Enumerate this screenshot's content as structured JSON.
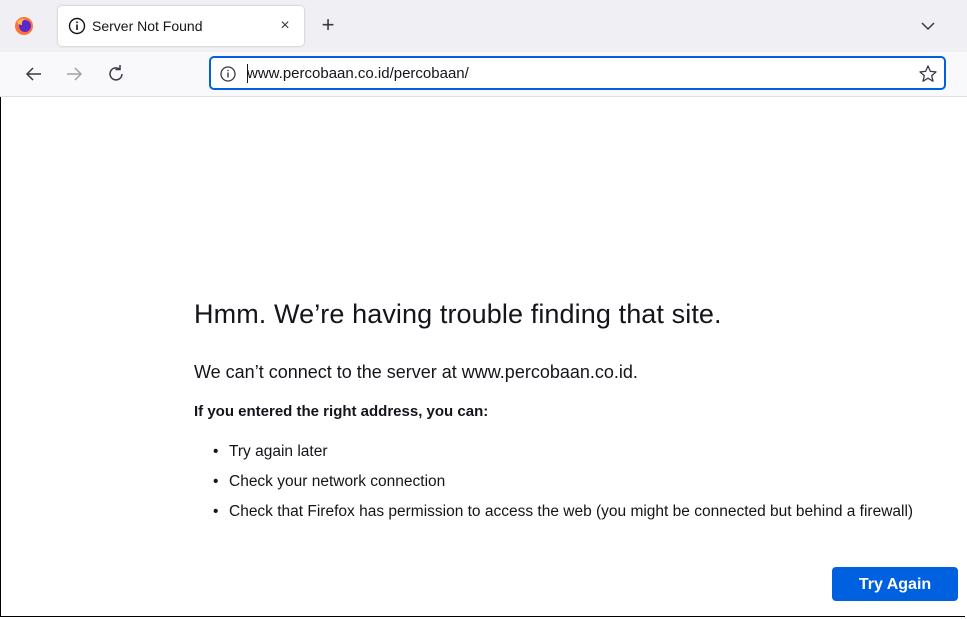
{
  "browser": {
    "tab": {
      "title": "Server Not Found",
      "close_label": "×"
    },
    "new_tab_label": "+",
    "url": "www.percobaan.co.id/percobaan/"
  },
  "error": {
    "title": "Hmm. We’re having trouble finding that site.",
    "description": "We can’t connect to the server at www.percobaan.co.id.",
    "subheading": "If you entered the right address, you can:",
    "suggestions": [
      "Try again later",
      "Check your network connection",
      "Check that Firefox has permission to access the web (you might be connected but behind a firewall)"
    ],
    "button_label": "Try Again"
  },
  "colors": {
    "accent": "#0061e0",
    "tabstrip": "#f0f0f4",
    "navbar": "#f9f9fb"
  },
  "icons": [
    "firefox-logo-icon",
    "info-icon",
    "close-icon",
    "plus-icon",
    "chevron-down-icon",
    "back-arrow-icon",
    "forward-arrow-icon",
    "reload-icon",
    "star-icon"
  ]
}
